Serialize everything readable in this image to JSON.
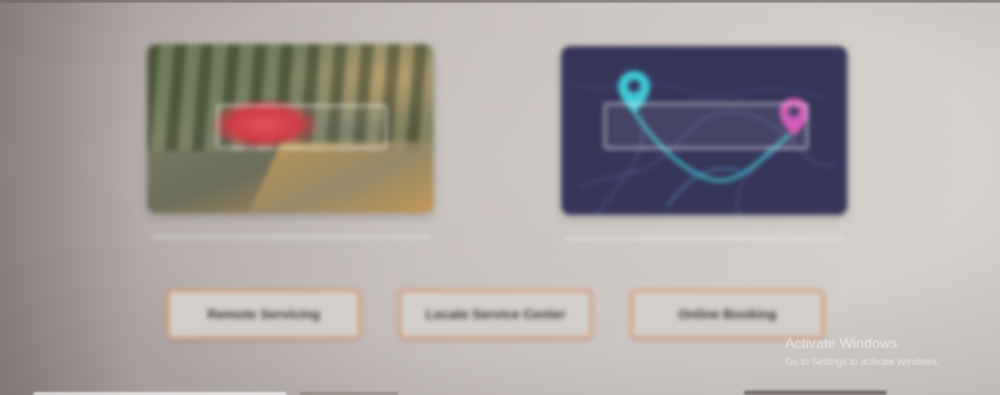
{
  "cards": [
    {
      "name": "photo-card",
      "image_desc": "car-on-trail-photo",
      "overlay_label": "",
      "caption": ""
    },
    {
      "name": "map-card",
      "image_desc": "route-map-illustration",
      "overlay_label": "",
      "caption": ""
    }
  ],
  "buttons": [
    {
      "label": "Remote Servicing"
    },
    {
      "label": "Locate Service Center"
    },
    {
      "label": "Online Booking"
    }
  ],
  "watermark": {
    "title": "Activate Windows",
    "subtitle": "Go to Settings to activate Windows."
  },
  "colors": {
    "button_border": "#d69b78",
    "map_background": "#36355a",
    "pin_teal": "#3fc9d6",
    "pin_pink": "#d24fb4"
  },
  "icons": [
    "location-pin-icon",
    "location-pin-icon"
  ]
}
